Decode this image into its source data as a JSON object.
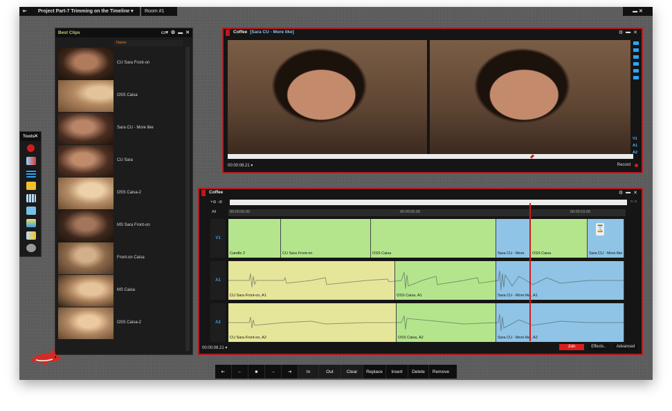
{
  "topbar": {
    "project_title": "Project Part-7 Trimming on the Timeline",
    "room": "Room #1"
  },
  "bin": {
    "title": "Best Clips",
    "column_header": "Name",
    "clips": [
      {
        "label": "CU Sara Front-on"
      },
      {
        "label": "OSS Caisa"
      },
      {
        "label": "Sara CU - More like"
      },
      {
        "label": "CU Sara"
      },
      {
        "label": "OSS Caisa-2"
      },
      {
        "label": "MS Sara Front-on"
      },
      {
        "label": "Front-on Caisa"
      },
      {
        "label": "MS Caisa"
      },
      {
        "label": "OSS Caisa-2"
      }
    ]
  },
  "tools": {
    "title": "Tools"
  },
  "viewer": {
    "title": "Coffee",
    "clip": "[Sara CU - More like]",
    "timecode": "00:00:08.21",
    "record_label": "Record",
    "tracks": [
      "V1",
      "A1",
      "A2"
    ]
  },
  "timeline": {
    "title": "Coffee",
    "all_label": "All",
    "ruler": [
      "00:00:00.00",
      "00:00:05.00",
      "00:00:10.00"
    ],
    "tracks": {
      "v1": {
        "name": "V1",
        "clips": [
          "Candle 2",
          "CU Sara Front-on",
          "OSS Caisa",
          "Sara CU - More",
          "OSS Caisa",
          "Sara CU - More like"
        ]
      },
      "a1": {
        "name": "A1",
        "clips": [
          "CU Sara Front-on, A1",
          "OSS Caisa, A1",
          "Sara CU - More like, A1"
        ]
      },
      "a2": {
        "name": "A2",
        "clips": [
          "CU Sara Front-on, A2",
          "OSS Caisa, A2",
          "Sara CU - More like, A2"
        ]
      }
    },
    "timecode": "00:00:08.21",
    "join_label": "Join",
    "effects_label": "Effects..",
    "advanced_label": "Advanced"
  },
  "transport": {
    "in_label": "In",
    "out_label": "Out",
    "clear_label": "Clear",
    "replace_label": "Replace",
    "insert_label": "Insert",
    "delete_label": "Delete",
    "remove_label": "Remove"
  },
  "colors": {
    "accent_red": "#b11b22",
    "v1_green": "#b4e58c",
    "audio_yellow": "#e6e69a",
    "selected_blue": "#8fc4e6"
  },
  "icons": [
    "menu-icon",
    "gear-icon",
    "close-icon",
    "record-icon",
    "skip-start-icon",
    "step-back-icon",
    "stop-icon",
    "step-forward-icon",
    "skip-end-icon",
    "hourglass-icon",
    "shark-logo"
  ]
}
